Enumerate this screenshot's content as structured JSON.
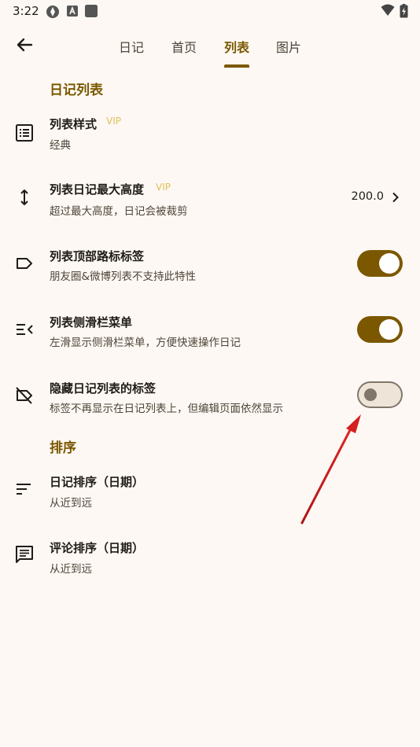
{
  "status_bar": {
    "time": "3:22",
    "icons": [
      "app-icon-1",
      "app-icon-a",
      "app-icon-square"
    ],
    "right_icons": [
      "wifi-icon",
      "battery-icon"
    ]
  },
  "header": {
    "tabs": [
      {
        "label": "日记",
        "active": false
      },
      {
        "label": "首页",
        "active": false
      },
      {
        "label": "列表",
        "active": true
      },
      {
        "label": "图片",
        "active": false
      }
    ]
  },
  "sections": {
    "diary_list": {
      "title": "日记列表",
      "items": [
        {
          "icon": "list-style-icon",
          "title": "列表样式",
          "vip": "VIP",
          "subtitle": "经典"
        },
        {
          "icon": "vertical-arrows-icon",
          "title": "列表日记最大高度",
          "vip": "VIP",
          "subtitle": "超过最大高度，日记会被裁剪",
          "value": "200.0"
        },
        {
          "icon": "label-icon",
          "title": "列表顶部路标标签",
          "subtitle": "朋友圈&微博列表不支持此特性",
          "toggle": true
        },
        {
          "icon": "side-menu-icon",
          "title": "列表侧滑栏菜单",
          "subtitle": "左滑显示侧滑栏菜单，方便快速操作日记",
          "toggle": true
        },
        {
          "icon": "label-off-icon",
          "title": "隐藏日记列表的标签",
          "subtitle": "标签不再显示在日记列表上，但编辑页面依然显示",
          "toggle": false
        }
      ]
    },
    "sort": {
      "title": "排序",
      "items": [
        {
          "icon": "sort-icon",
          "title": "日记排序（日期）",
          "subtitle": "从近到远"
        },
        {
          "icon": "comment-icon",
          "title": "评论排序（日期）",
          "subtitle": "从近到远"
        }
      ]
    }
  },
  "colors": {
    "accent": "#7b5800",
    "background": "#fdf8f4",
    "vip": "#e0c05a",
    "annotation_arrow": "#d42020"
  }
}
